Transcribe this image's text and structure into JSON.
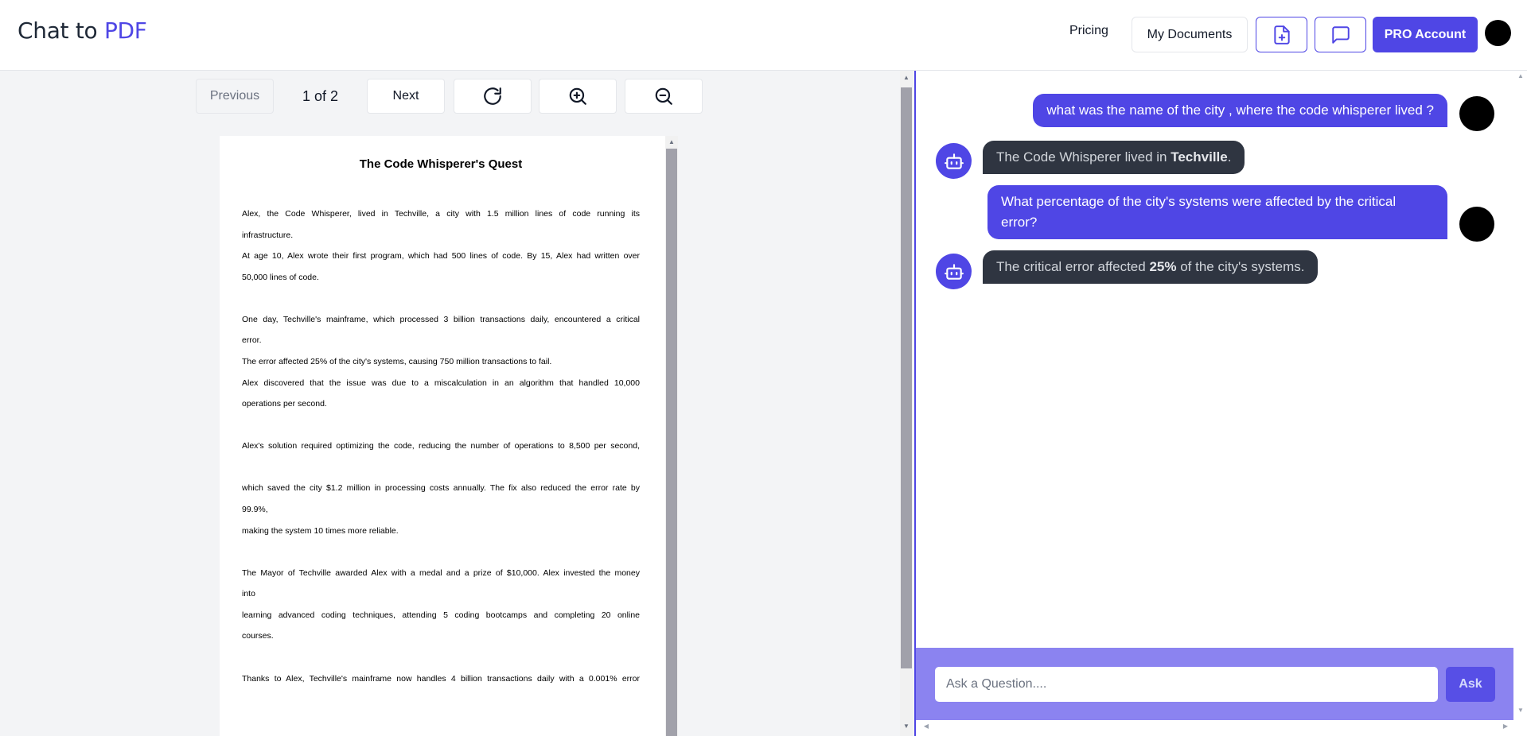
{
  "header": {
    "logo_part1": "Chat to",
    "logo_part2": "PDF",
    "pricing": "Pricing",
    "my_documents": "My Documents",
    "upload_icon": "file-plus-icon",
    "chat_icon": "message-square-icon",
    "pro_account": "PRO Account"
  },
  "pdf": {
    "toolbar": {
      "previous": "Previous",
      "page_indicator": "1 of 2",
      "next": "Next",
      "rotate_icon": "rotate-cw-icon",
      "zoom_in_icon": "zoom-in-icon",
      "zoom_out_icon": "zoom-out-icon"
    },
    "title": "The Code Whisperer's Quest",
    "lines": [
      "Alex, the Code Whisperer, lived in Techville, a city with 1.5 million lines of code running its",
      "infrastructure.",
      "At age 10, Alex wrote their first program, which had 500 lines of code. By 15, Alex had written over",
      "50,000 lines of code.",
      "One day, Techville's mainframe, which processed 3 billion transactions daily, encountered a critical",
      "error.",
      "The error affected 25% of the city's systems, causing 750 million transactions to fail.",
      "Alex discovered that the issue was due to a miscalculation in an algorithm that handled 10,000",
      "operations per second.",
      "Alex's solution required optimizing the code, reducing the number of operations to 8,500 per second,",
      "which saved the city $1.2 million in processing costs annually. The fix also reduced the error rate by",
      "99.9%,",
      "making the system 10 times more reliable.",
      "The Mayor of Techville awarded Alex with a medal and a prize of $10,000. Alex invested the money",
      "into",
      "learning advanced coding techniques, attending 5 coding bootcamps and completing 20 online",
      "courses.",
      "Thanks to Alex, Techville's mainframe now handles 4 billion transactions daily with a 0.001% error"
    ]
  },
  "chat": {
    "messages": [
      {
        "role": "user",
        "text": "what was the name of the city , where the code whisperer lived ?"
      },
      {
        "role": "bot",
        "pre": "The Code Whisperer lived in ",
        "bold": "Techville",
        "post": "."
      },
      {
        "role": "user",
        "text": "What percentage of the city's systems were affected by the critical error?"
      },
      {
        "role": "bot",
        "pre": "The critical error affected ",
        "bold": "25%",
        "post": " of the city's systems."
      }
    ],
    "input_placeholder": "Ask a Question....",
    "input_value": "",
    "ask_label": "Ask",
    "bot_icon": "robot-icon"
  },
  "colors": {
    "accent": "#4f46e5",
    "input_bar": "#8b83f0",
    "bot_bubble": "#2f3541"
  }
}
